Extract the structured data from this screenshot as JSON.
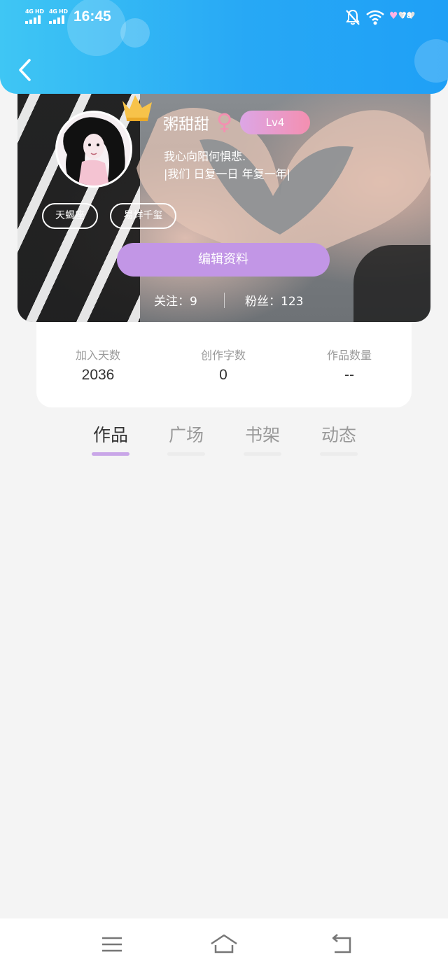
{
  "status_bar": {
    "network1": "4G HD",
    "network2": "4G HD",
    "time": "16:45",
    "battery": "78"
  },
  "profile": {
    "name": "粥甜甜",
    "gender_symbol": "♀",
    "level": "Lv4",
    "signature_line1": "我心向阳何惧悲.",
    "signature_line2": "|我们  日复一日 年复一年|",
    "tags": [
      "天蝎座",
      "易烊千玺"
    ],
    "edit_button": "编辑资料",
    "following": "关注：9",
    "followers": "粉丝：123"
  },
  "stats": [
    {
      "label": "加入天数",
      "value": "2036"
    },
    {
      "label": "创作字数",
      "value": "0"
    },
    {
      "label": "作品数量",
      "value": "--"
    }
  ],
  "tabs": [
    {
      "label": "作品",
      "active": true
    },
    {
      "label": "广场",
      "active": false
    },
    {
      "label": "书架",
      "active": false
    },
    {
      "label": "动态",
      "active": false
    }
  ],
  "colors": {
    "header_start": "#3fc6f4",
    "header_end": "#1fa0f6",
    "accent_purple": "#c296e6",
    "tab_indicator": "#c9a6e8",
    "level_badge_start": "#dca6e6",
    "level_badge_end": "#f48fb0"
  },
  "icons": {
    "back": "chevron-left-icon",
    "menu": "menu-icon",
    "home": "home-icon",
    "return": "back-arrow-icon"
  }
}
